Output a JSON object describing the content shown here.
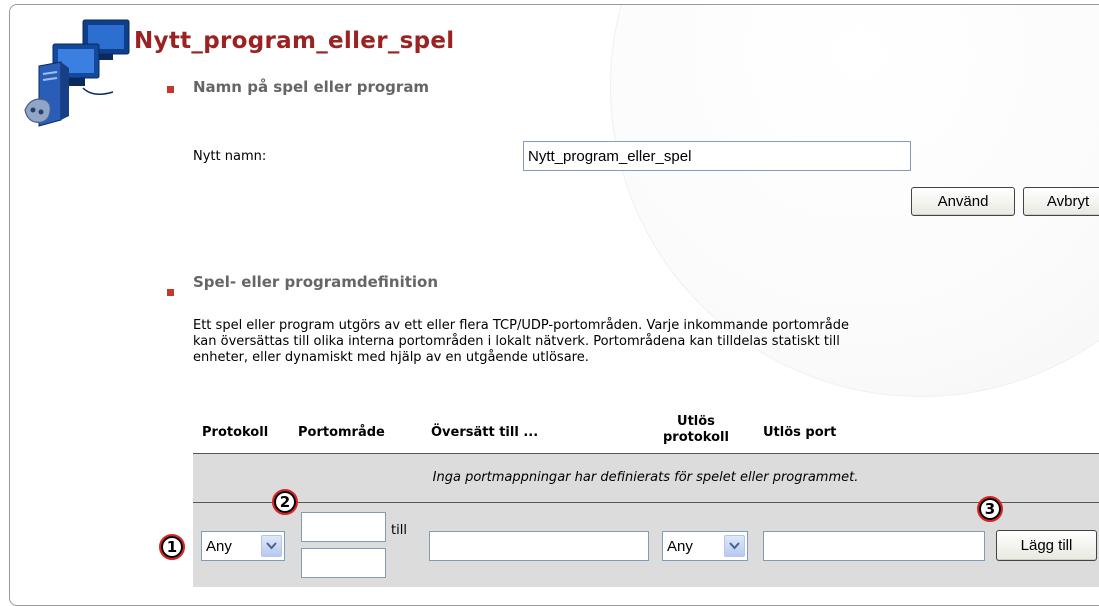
{
  "page": {
    "title": "Nytt_program_eller_spel"
  },
  "section_name": {
    "heading": "Namn på spel eller program",
    "new_name_label": "Nytt namn:",
    "new_name_value": "Nytt_program_eller_spel",
    "apply_button": "Använd",
    "cancel_button": "Avbryt"
  },
  "section_definition": {
    "heading": "Spel- eller programdefinition",
    "description": [
      "Ett spel eller program utgörs av ett eller flera TCP/UDP-portområden. Varje inkommande portområde",
      "kan översättas till olika interna portområden i lokalt nätverk. Portområdena kan tilldelas statiskt till",
      "enheter, eller dynamiskt med hjälp av en utgående utlösare."
    ]
  },
  "table": {
    "headers": {
      "protocol": "Protokoll",
      "port_range": "Portområde",
      "translate_to": "Översätt till ...",
      "trigger_protocol_line1": "Utlös",
      "trigger_protocol_line2": "protokoll",
      "trigger_port": "Utlös port"
    },
    "empty_message": "Inga portmappningar har definierats för spelet eller programmet.",
    "new_row": {
      "protocol_selected": "Any",
      "to_label": "till",
      "trigger_protocol_selected": "Any",
      "add_button": "Lägg till"
    }
  },
  "callouts": {
    "one": "1",
    "two": "2",
    "three": "3"
  },
  "colors": {
    "title": "#9b2222",
    "bullet": "#c0392b",
    "heading_grey": "#666666",
    "row_grey": "#dcdcdc",
    "callout_ring": "#e02020"
  }
}
